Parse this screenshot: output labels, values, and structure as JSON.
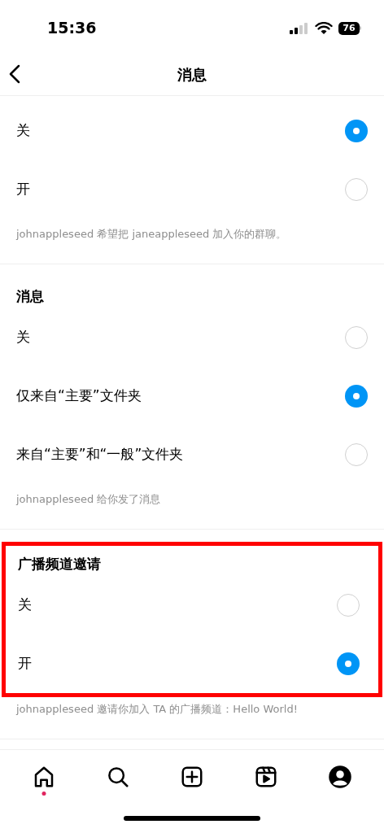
{
  "status_bar": {
    "time": "15:36",
    "battery": "76"
  },
  "header": {
    "title": "消息"
  },
  "sections": [
    {
      "highlighted": false,
      "options": [
        {
          "label": "关",
          "selected": true
        },
        {
          "label": "开",
          "selected": false
        }
      ],
      "caption": "johnappleseed 希望把 janeappleseed 加入你的群聊。"
    },
    {
      "title": "消息",
      "highlighted": false,
      "options": [
        {
          "label": "关",
          "selected": false
        },
        {
          "label": "仅来自“主要”文件夹",
          "selected": true
        },
        {
          "label": "来自“主要”和“一般”文件夹",
          "selected": false
        }
      ],
      "caption": "johnappleseed 给你发了消息"
    },
    {
      "title": "广播频道邀请",
      "highlighted": true,
      "options": [
        {
          "label": "关",
          "selected": false
        },
        {
          "label": "开",
          "selected": true
        }
      ],
      "caption": "johnappleseed 邀请你加入 TA 的广播频道：Hello World!"
    }
  ],
  "nav": [
    {
      "kind": "home",
      "selected": true
    },
    {
      "kind": "search",
      "selected": false
    },
    {
      "kind": "create",
      "selected": false
    },
    {
      "kind": "reels",
      "selected": false
    },
    {
      "kind": "profile",
      "selected": false
    }
  ]
}
